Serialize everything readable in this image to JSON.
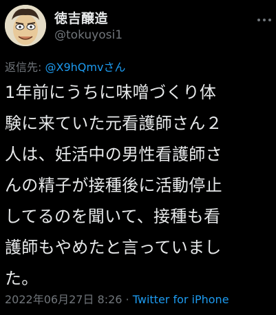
{
  "user": {
    "display_name": "徳吉醸造",
    "handle": "@tokuyosi1",
    "avatar_icon": "user-avatar-icon"
  },
  "reply": {
    "prefix": "返信先: ",
    "mention": "@X9hQmvさん"
  },
  "tweet": {
    "lines": [
      "1年前にうちに味噌づくり体",
      "験に来ていた元看護師さん２",
      "人は、妊活中の男性看護師さ",
      "んの精子が接種後に活動停止",
      "してるのを聞いて、接種も看",
      "護師もやめたと言っていまし",
      "た。"
    ]
  },
  "meta": {
    "timestamp": "2022年06月27日 8:26",
    "separator": " · ",
    "source": "Twitter for iPhone"
  },
  "colors": {
    "background": "#000000",
    "text": "#e7e9ea",
    "secondary": "#71767b",
    "link": "#1d9bf0"
  },
  "icons": {
    "more": "more-options-icon"
  }
}
